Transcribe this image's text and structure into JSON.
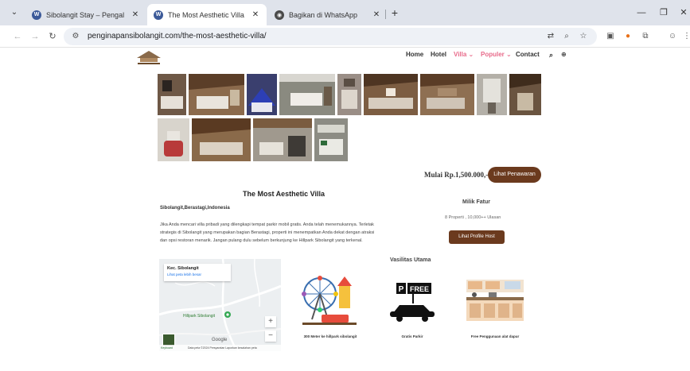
{
  "browser": {
    "tabs": [
      {
        "title": "Sibolangit Stay – Pengalaman I",
        "active": false
      },
      {
        "title": "The Most Aesthetic Villa – Sibo",
        "active": true
      },
      {
        "title": "Bagikan di WhatsApp",
        "active": false
      }
    ],
    "url": "penginapansibolangit.com/the-most-aesthetic-villa/"
  },
  "site": {
    "nav": [
      {
        "label": "Home"
      },
      {
        "label": "Hotel"
      },
      {
        "label": "Villa ⌄"
      },
      {
        "label": "Populer ⌄"
      },
      {
        "label": "Contact"
      }
    ]
  },
  "listing": {
    "price": "Mulai Rp.1,500.000,-",
    "offer_button": "Lihat Penawaran",
    "title": "The Most Aesthetic Villa",
    "location": "Sibolangit,Berastagi,Indonesia",
    "description": "Jika Anda mencari villa pribadi yang dilengkapi tempat parkir mobil gratis. Anda telah menemukannya. Terletak strategis di Sibolangit yang merupakan bagian Berastagi, properti ini menempatkan Anda dekat dengan atraksi dan opsi restoran menarik. Jangan pulang dulu sebelum berkunjung ke Hillpark Sibolangit yang terkenal."
  },
  "host": {
    "name": "Milik Fatur",
    "stats": "8 Properti , 10,000++ Ulasan",
    "button": "Lihat Profile Host"
  },
  "map": {
    "place": "Kec. Sibolangit",
    "link": "Lihat peta lebih besar",
    "poi": "Hillpark Sibolangit",
    "zoom_in": "+",
    "zoom_out": "−",
    "google": "Google",
    "footer": "Data peta ©2024   Persyaratan   Laporkan kesalahan peta",
    "thumb_label": "Keyboard"
  },
  "amenities": {
    "title": "Vasilitas Utama",
    "items": [
      {
        "caption": "300 Meter ke hillpark sibolangit"
      },
      {
        "caption": "Gratis Parkir"
      },
      {
        "caption": "Free Penggunaan alat dapur"
      }
    ],
    "parking_sign": "FREE"
  }
}
